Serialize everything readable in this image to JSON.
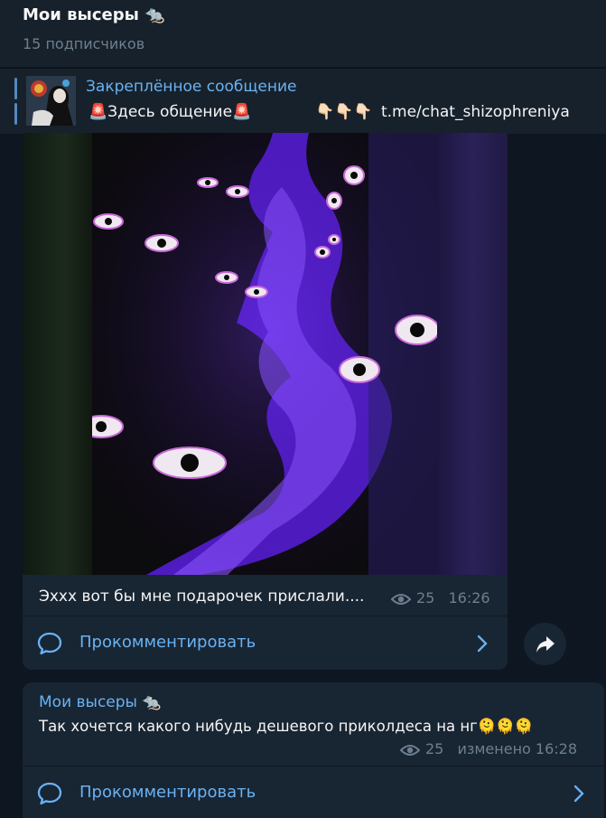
{
  "header": {
    "title": "Мои высеры 🐀",
    "subtitle": "15 подписчиков"
  },
  "pinned": {
    "label": "Закреплённое сообщение",
    "text_prefix": "🚨Здесь общение🚨",
    "pointers": "👇🏻👇🏻👇🏻",
    "link": "t.me/chat_shizophreniya"
  },
  "post1": {
    "caption": "Эххх вот бы мне подарочек прислали....",
    "views": "25",
    "time": "16:26",
    "comment_label": "Прокомментировать"
  },
  "post2": {
    "author": "Мои высеры 🐀",
    "text": "Так хочется какого нибудь дешевого приколдеса на нг🫠🫠🫠",
    "views": "25",
    "edited": "изменено 16:28",
    "comment_label": "Прокомментировать"
  },
  "colors": {
    "background": "#0e1621",
    "panel": "#17212b",
    "bubble": "#182533",
    "accent": "#6ab2f2",
    "muted": "#6d7f8f"
  },
  "icons": [
    "eye-icon",
    "comment-bubble-icon",
    "chevron-right-icon",
    "share-arrow-icon"
  ]
}
